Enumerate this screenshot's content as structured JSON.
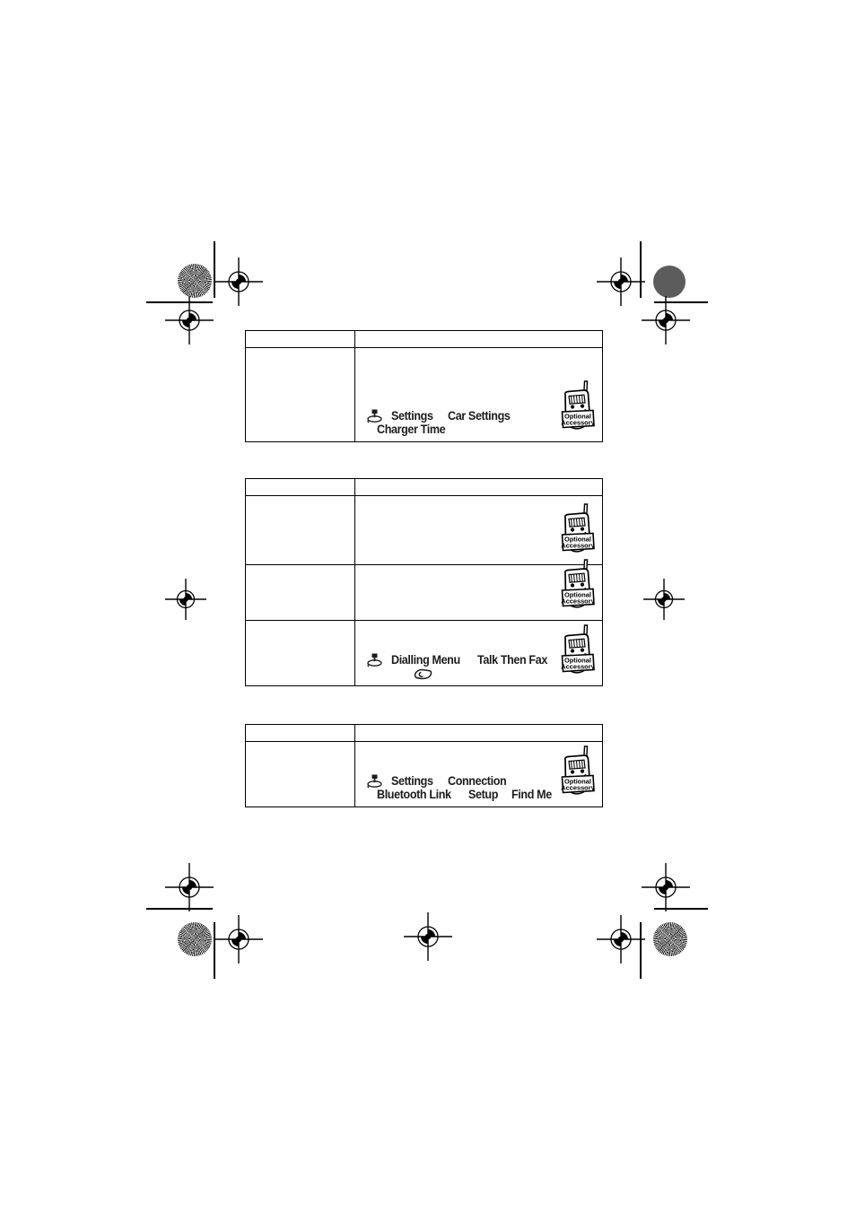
{
  "document": {
    "type": "printed-manual-page",
    "background_color": "#ffffff",
    "ink_color": "#1c1c1c"
  },
  "icons": {
    "nav_key": "joystick-nav-key-icon",
    "send_key": "send-key-icon",
    "optional_accessory": "optional-accessory-phone-icon"
  },
  "optional_accessory_badge": {
    "line1": "Optional",
    "line2": "Accessory"
  },
  "tables": [
    {
      "id": "table-charger-time",
      "header": {
        "left": "",
        "right": ""
      },
      "rows": [
        {
          "left": "",
          "path_lines": [
            [
              "Settings",
              "Car Settings"
            ],
            [
              "Charger Time"
            ]
          ],
          "has_nav_key": true,
          "has_send_key": false,
          "has_optional_accessory": true
        }
      ]
    },
    {
      "id": "table-dialling-menu",
      "header": {
        "left": "",
        "right": ""
      },
      "rows": [
        {
          "left": "",
          "path_lines": [],
          "has_nav_key": false,
          "has_send_key": false,
          "has_optional_accessory": true
        },
        {
          "left": "",
          "path_lines": [],
          "has_nav_key": false,
          "has_send_key": false,
          "has_optional_accessory": true
        },
        {
          "left": "",
          "path_lines": [
            [
              "Dialling Menu",
              "Talk Then Fax"
            ]
          ],
          "has_nav_key": true,
          "has_send_key": true,
          "has_optional_accessory": true
        }
      ]
    },
    {
      "id": "table-bluetooth-find-me",
      "header": {
        "left": "",
        "right": ""
      },
      "rows": [
        {
          "left": "",
          "path_lines": [
            [
              "Settings",
              "Connection"
            ],
            [
              "Bluetooth Link",
              "Setup",
              "Find Me"
            ]
          ],
          "has_nav_key": true,
          "has_send_key": false,
          "has_optional_accessory": true
        }
      ]
    }
  ],
  "printer_marks": {
    "registration_targets": 8,
    "halftone_star_patches": 2,
    "solid_density_patches": 2,
    "crop_lines": 8
  }
}
